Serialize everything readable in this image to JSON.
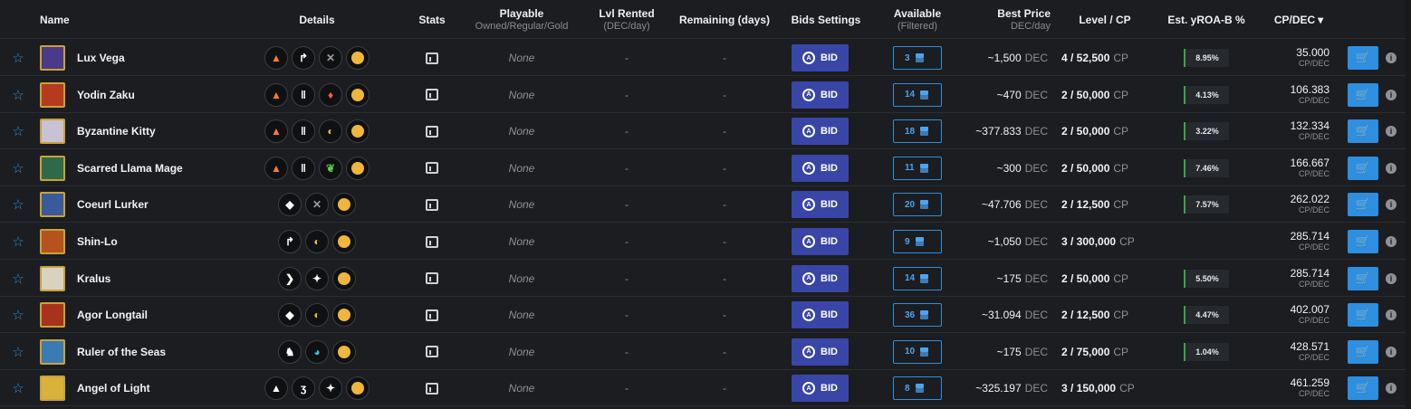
{
  "header": {
    "name": "Name",
    "details": "Details",
    "stats": "Stats",
    "playable": "Playable",
    "playable_sub": "Owned/Regular/Gold",
    "lvl_rented": "Lvl Rented",
    "lvl_rented_sub": "(DEC/day)",
    "remaining": "Remaining (days)",
    "bids_settings": "Bids Settings",
    "available": "Available",
    "available_sub": "(Filtered)",
    "best_price": "Best Price",
    "best_price_sub": "DEC/day",
    "level_cp": "Level / CP",
    "est_yroa": "Est. yROA-B %",
    "cp_dec": "CP/DEC"
  },
  "labels": {
    "bid": "BID",
    "dec_unit": "DEC",
    "cp_unit": "CP",
    "cpdec_unit": "CP/DEC",
    "none": "None",
    "dash": "-",
    "sort_icon": "▾",
    "star_icon": "☆",
    "cart_icon": "🛒",
    "info_icon": "i"
  },
  "colors": {
    "accent_blue": "#2e8fe0",
    "bid_button": "#3a45a8",
    "gold_coin": "#f0b63c",
    "yroa_bar": "#3fa34a"
  },
  "rows": [
    {
      "name": "Lux Vega",
      "avatar_color": "#4a3a8a",
      "details": [
        {
          "icon": "fire-icon",
          "g": "▲",
          "c": "#ff7a2e"
        },
        {
          "icon": "arrow-icon",
          "g": "↱",
          "c": "#ffffff"
        },
        {
          "icon": "swords-icon",
          "g": "✕",
          "c": "#9a9da1"
        },
        {
          "icon": "coin-icon",
          "g": "",
          "c": "#f0b63c"
        }
      ],
      "playable": "None",
      "lvl_rented": "-",
      "remaining": "-",
      "available": "3",
      "best_price": "~1,500",
      "level": "4 / 52,500",
      "yroa": "8.95%",
      "cpdec": "35.000"
    },
    {
      "name": "Yodin Zaku",
      "avatar_color": "#b53a1e",
      "details": [
        {
          "icon": "fire-icon",
          "g": "▲",
          "c": "#ff7a2e"
        },
        {
          "icon": "pillar-icon",
          "g": "‖",
          "c": "#ffffff"
        },
        {
          "icon": "flame-icon",
          "g": "♦",
          "c": "#ff5a4a"
        },
        {
          "icon": "coin-icon",
          "g": "",
          "c": "#f0b63c"
        }
      ],
      "playable": "None",
      "lvl_rented": "-",
      "remaining": "-",
      "available": "14",
      "best_price": "~470",
      "level": "2 / 50,000",
      "yroa": "4.13%",
      "cpdec": "106.383"
    },
    {
      "name": "Byzantine Kitty",
      "avatar_color": "#c9c2d4",
      "details": [
        {
          "icon": "fire-icon",
          "g": "▲",
          "c": "#ff7a2e"
        },
        {
          "icon": "pillar-icon",
          "g": "‖",
          "c": "#ffffff"
        },
        {
          "icon": "moon-icon",
          "g": "◐",
          "c": "#f0c020"
        },
        {
          "icon": "coin-icon",
          "g": "",
          "c": "#f0b63c"
        }
      ],
      "playable": "None",
      "lvl_rented": "-",
      "remaining": "-",
      "available": "18",
      "best_price": "~377.833",
      "level": "2 / 50,000",
      "yroa": "3.22%",
      "cpdec": "132.334"
    },
    {
      "name": "Scarred Llama Mage",
      "avatar_color": "#2e6a4a",
      "details": [
        {
          "icon": "fire-icon",
          "g": "▲",
          "c": "#ff7a2e"
        },
        {
          "icon": "pillar-icon",
          "g": "‖",
          "c": "#ffffff"
        },
        {
          "icon": "leaf-icon",
          "g": "❦",
          "c": "#5ad03a"
        },
        {
          "icon": "coin-icon",
          "g": "",
          "c": "#f0b63c"
        }
      ],
      "playable": "None",
      "lvl_rented": "-",
      "remaining": "-",
      "available": "11",
      "best_price": "~300",
      "level": "2 / 50,000",
      "yroa": "7.46%",
      "cpdec": "166.667"
    },
    {
      "name": "Coeurl Lurker",
      "avatar_color": "#3a5a9a",
      "details": [
        {
          "icon": "chevrons-icon",
          "g": "◆",
          "c": "#ffffff"
        },
        {
          "icon": "swords-icon",
          "g": "✕",
          "c": "#9a9da1"
        },
        {
          "icon": "coin-icon",
          "g": "",
          "c": "#f0b63c"
        }
      ],
      "playable": "None",
      "lvl_rented": "-",
      "remaining": "-",
      "available": "20",
      "best_price": "~47.706",
      "level": "2 / 12,500",
      "yroa": "7.57%",
      "cpdec": "262.022"
    },
    {
      "name": "Shin-Lo",
      "avatar_color": "#b5521e",
      "details": [
        {
          "icon": "arrow-icon",
          "g": "↱",
          "c": "#ffffff"
        },
        {
          "icon": "moon-icon",
          "g": "◐",
          "c": "#f0c020"
        },
        {
          "icon": "coin-icon",
          "g": "",
          "c": "#f0b63c"
        }
      ],
      "playable": "None",
      "lvl_rented": "-",
      "remaining": "-",
      "available": "9",
      "best_price": "~1,050",
      "level": "3 / 300,000",
      "yroa": "",
      "cpdec": "285.714"
    },
    {
      "name": "Kralus",
      "avatar_color": "#d8d2c0",
      "details": [
        {
          "icon": "chevron-right-icon",
          "g": "❯",
          "c": "#ffffff"
        },
        {
          "icon": "compass-icon",
          "g": "✦",
          "c": "#ffffff"
        },
        {
          "icon": "coin-icon",
          "g": "",
          "c": "#f0b63c"
        }
      ],
      "playable": "None",
      "lvl_rented": "-",
      "remaining": "-",
      "available": "14",
      "best_price": "~175",
      "level": "2 / 50,000",
      "yroa": "5.50%",
      "cpdec": "285.714"
    },
    {
      "name": "Agor Longtail",
      "avatar_color": "#a8321e",
      "details": [
        {
          "icon": "chevrons-icon",
          "g": "◆",
          "c": "#ffffff"
        },
        {
          "icon": "moon-icon",
          "g": "◐",
          "c": "#f0c020"
        },
        {
          "icon": "coin-icon",
          "g": "",
          "c": "#f0b63c"
        }
      ],
      "playable": "None",
      "lvl_rented": "-",
      "remaining": "-",
      "available": "36",
      "best_price": "~31.094",
      "level": "2 / 12,500",
      "yroa": "4.47%",
      "cpdec": "402.007"
    },
    {
      "name": "Ruler of the Seas",
      "avatar_color": "#3a7ab5",
      "details": [
        {
          "icon": "knight-icon",
          "g": "♞",
          "c": "#ffffff"
        },
        {
          "icon": "wave-icon",
          "g": "◕",
          "c": "#2ec8e0"
        },
        {
          "icon": "coin-icon",
          "g": "",
          "c": "#f0b63c"
        }
      ],
      "playable": "None",
      "lvl_rented": "-",
      "remaining": "-",
      "available": "10",
      "best_price": "~175",
      "level": "2 / 75,000",
      "yroa": "1.04%",
      "cpdec": "428.571"
    },
    {
      "name": "Angel of Light",
      "avatar_color": "#d8b23a",
      "details": [
        {
          "icon": "spike-icon",
          "g": "▲",
          "c": "#ffffff"
        },
        {
          "icon": "bolt-icon",
          "g": "ʒ",
          "c": "#ffffff"
        },
        {
          "icon": "compass-icon",
          "g": "✦",
          "c": "#ffffff"
        },
        {
          "icon": "coin-icon",
          "g": "",
          "c": "#f0b63c"
        }
      ],
      "playable": "None",
      "lvl_rented": "-",
      "remaining": "-",
      "available": "8",
      "best_price": "~325.197",
      "level": "3 / 150,000",
      "yroa": "",
      "cpdec": "461.259"
    }
  ]
}
